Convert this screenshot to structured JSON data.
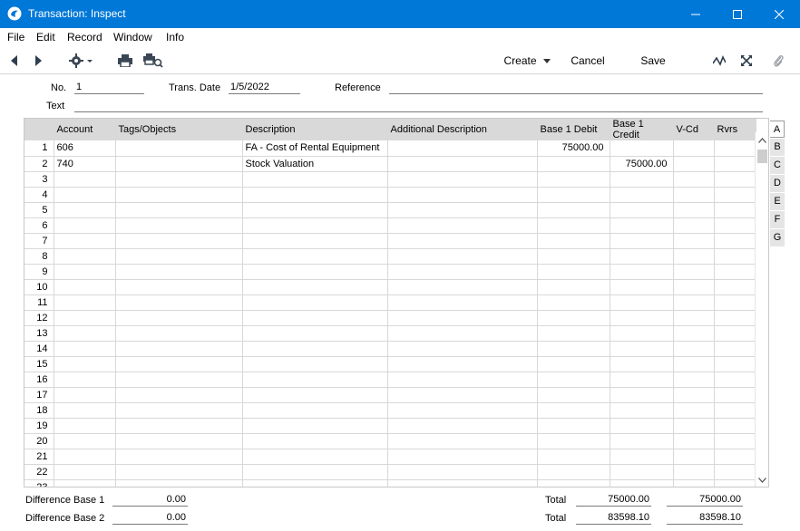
{
  "window": {
    "title": "Transaction: Inspect",
    "accent_color": "#0078d7"
  },
  "menu": [
    "File",
    "Edit",
    "Record",
    "Window",
    "Info"
  ],
  "toolbar": {
    "create_label": "Create",
    "cancel_label": "Cancel",
    "save_label": "Save"
  },
  "header": {
    "no_label": "No.",
    "no_value": "1",
    "trans_date_label": "Trans. Date",
    "trans_date_value": "1/5/2022",
    "reference_label": "Reference",
    "reference_value": "",
    "text_label": "Text",
    "text_value": ""
  },
  "grid": {
    "columns": [
      "",
      "Account",
      "Tags/Objects",
      "Description",
      "Additional Description",
      "Base 1 Debit",
      "Base 1 Credit",
      "V-Cd",
      "Rvrs"
    ],
    "rows": [
      {
        "n": "1",
        "account": "606",
        "tags": "",
        "description": "FA - Cost of Rental Equipment",
        "additional": "",
        "debit": "75000.00",
        "credit": "",
        "vcd": "",
        "rvrs": ""
      },
      {
        "n": "2",
        "account": "740",
        "tags": "",
        "description": "Stock Valuation",
        "additional": "",
        "debit": "",
        "credit": "75000.00",
        "vcd": "",
        "rvrs": ""
      },
      {
        "n": "3"
      },
      {
        "n": "4"
      },
      {
        "n": "5"
      },
      {
        "n": "6"
      },
      {
        "n": "7"
      },
      {
        "n": "8"
      },
      {
        "n": "9"
      },
      {
        "n": "10"
      },
      {
        "n": "11"
      },
      {
        "n": "12"
      },
      {
        "n": "13"
      },
      {
        "n": "14"
      },
      {
        "n": "15"
      },
      {
        "n": "16"
      },
      {
        "n": "17"
      },
      {
        "n": "18"
      },
      {
        "n": "19"
      },
      {
        "n": "20"
      },
      {
        "n": "21"
      },
      {
        "n": "22"
      },
      {
        "n": "23"
      }
    ]
  },
  "tabs": [
    "A",
    "B",
    "C",
    "D",
    "E",
    "F",
    "G"
  ],
  "footer": {
    "diff1_label": "Difference Base 1",
    "diff1_value": "0.00",
    "diff2_label": "Difference Base 2",
    "diff2_value": "0.00",
    "total1_label": "Total",
    "total1_debit": "75000.00",
    "total1_credit": "75000.00",
    "total2_label": "Total",
    "total2_debit": "83598.10",
    "total2_credit": "83598.10"
  }
}
